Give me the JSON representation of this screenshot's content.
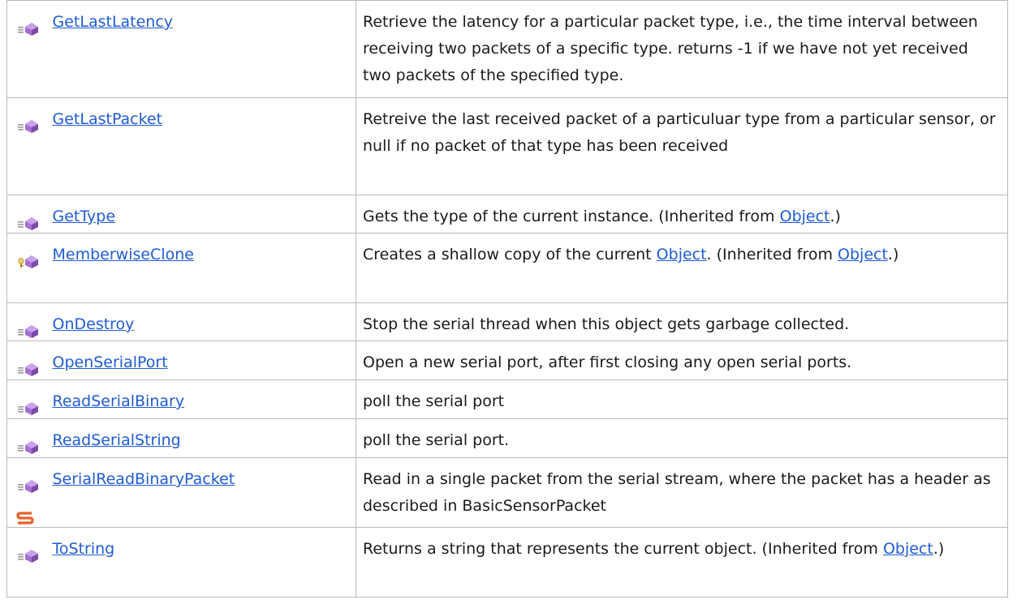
{
  "members": [
    {
      "name": "GetLastLatency",
      "icon": "public-method-icon",
      "description": "Retrieve the latency for a particular packet type, i.e., the time interval between receiving two packets of a specific type. returns -1 if we have not yet received two packets of the specified type."
    },
    {
      "name": "GetLastPacket",
      "icon": "public-method-icon",
      "description": "Retreive the last received packet of a particuluar type from a particular sensor, or null if no packet of that type has been received"
    },
    {
      "name": "GetType",
      "icon": "public-method-icon",
      "description_pre": "Gets the type of the current instance. (Inherited from ",
      "description_link": "Object",
      "description_post": ".)"
    },
    {
      "name": "MemberwiseClone",
      "icon": "protected-method-icon",
      "description_pre": "Creates a shallow copy of the current ",
      "description_link": "Object",
      "description_mid": ". (Inherited from ",
      "description_link2": "Object",
      "description_post": ".)"
    },
    {
      "name": "OnDestroy",
      "icon": "public-method-icon",
      "description": "Stop the serial thread when this object gets garbage collected."
    },
    {
      "name": "OpenSerialPort",
      "icon": "public-method-icon",
      "description": "Open a new serial port, after first closing any open serial ports."
    },
    {
      "name": "ReadSerialBinary",
      "icon": "public-method-icon",
      "description": "poll the serial port"
    },
    {
      "name": "ReadSerialString",
      "icon": "public-method-icon",
      "description": "poll the serial port."
    },
    {
      "name": "SerialReadBinaryPacket",
      "icon": "public-method-icon",
      "static_icon": "static-member-icon",
      "description": "Read in a single packet from the serial stream, where the packet has a header as described in BasicSensorPacket"
    },
    {
      "name": "ToString",
      "icon": "public-method-icon",
      "description_pre": "Returns a string that represents the current object. (Inherited from ",
      "description_link": "Object",
      "description_post": ".)"
    }
  ],
  "colors": {
    "link": "#1f5cd1",
    "border": "#b9b9b9",
    "method_purple": "#a66fd1",
    "static_orange": "#e8622a"
  }
}
